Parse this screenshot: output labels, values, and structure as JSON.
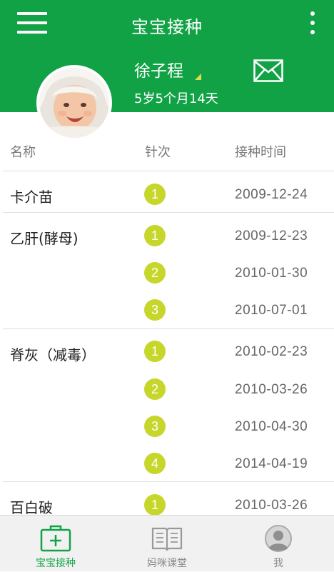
{
  "header": {
    "title": "宝宝接种",
    "menu_icon": "hamburger-menu-icon",
    "more_icon": "more-vertical-icon",
    "mail_icon": "mail-envelope-icon",
    "brand_color": "#11a246"
  },
  "child": {
    "name": "徐子程",
    "age": "5岁5个月14天"
  },
  "table": {
    "columns": [
      "名称",
      "针次",
      "接种时间"
    ],
    "vaccines": [
      {
        "name": "卡介苗",
        "doses": [
          {
            "no": "1",
            "date": "2009-12-24"
          }
        ]
      },
      {
        "name": "乙肝(酵母)",
        "doses": [
          {
            "no": "1",
            "date": "2009-12-23"
          },
          {
            "no": "2",
            "date": "2010-01-30"
          },
          {
            "no": "3",
            "date": "2010-07-01"
          }
        ]
      },
      {
        "name": "脊灰（减毒）",
        "doses": [
          {
            "no": "1",
            "date": "2010-02-23"
          },
          {
            "no": "2",
            "date": "2010-03-26"
          },
          {
            "no": "3",
            "date": "2010-04-30"
          },
          {
            "no": "4",
            "date": "2014-04-19"
          }
        ]
      },
      {
        "name": "百白破",
        "doses": [
          {
            "no": "1",
            "date": "2010-03-26"
          }
        ]
      }
    ],
    "dose_badge_color": "#c6d62a"
  },
  "tabs": [
    {
      "label": "宝宝接种",
      "icon": "medical-kit-icon",
      "active": true
    },
    {
      "label": "妈咪课堂",
      "icon": "open-book-icon",
      "active": false
    },
    {
      "label": "我",
      "icon": "user-avatar-icon",
      "active": false
    }
  ]
}
